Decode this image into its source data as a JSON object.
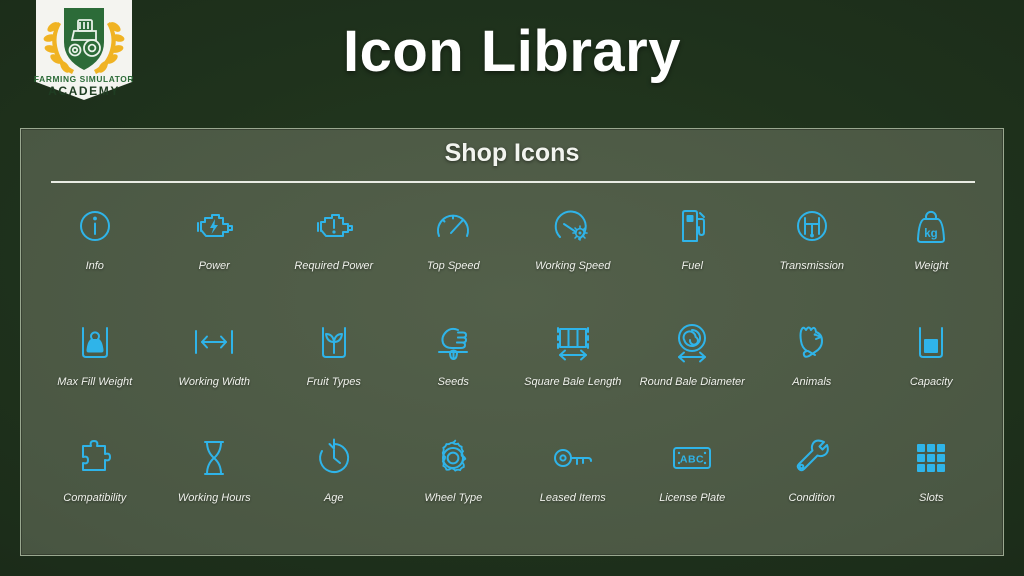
{
  "header": {
    "title": "Icon Library",
    "logo": {
      "name": "farming-simulator-academy-logo",
      "line1": "FARMING SIMULATOR",
      "line2": "ACADEMY"
    }
  },
  "panel": {
    "heading": "Shop Icons"
  },
  "colors": {
    "page_background": "#1c2d1a",
    "panel_background": "#4a5743",
    "panel_border": "#9aa890",
    "icon_accent": "#2fb4e9",
    "text": "#f0f2ec",
    "logo_shield_green": "#2c6b38",
    "logo_wheat_gold": "#f0b323"
  },
  "icons": [
    {
      "label": "Info",
      "icon": "info-circle-icon"
    },
    {
      "label": "Power",
      "icon": "engine-bolt-icon"
    },
    {
      "label": "Required Power",
      "icon": "engine-exclamation-icon"
    },
    {
      "label": "Top Speed",
      "icon": "speedometer-icon"
    },
    {
      "label": "Working Speed",
      "icon": "speedometer-gear-icon"
    },
    {
      "label": "Fuel",
      "icon": "fuel-pump-icon"
    },
    {
      "label": "Transmission",
      "icon": "gear-shifter-icon"
    },
    {
      "label": "Weight",
      "icon": "kg-weight-icon"
    },
    {
      "label": "Max Fill Weight",
      "icon": "weight-in-container-icon"
    },
    {
      "label": "Working Width",
      "icon": "width-arrow-icon"
    },
    {
      "label": "Fruit Types",
      "icon": "sprout-container-icon"
    },
    {
      "label": "Seeds",
      "icon": "hand-sowing-icon"
    },
    {
      "label": "Square Bale Length",
      "icon": "square-bale-arrow-icon"
    },
    {
      "label": "Round Bale Diameter",
      "icon": "round-bale-spiral-icon"
    },
    {
      "label": "Animals",
      "icon": "chicken-icon"
    },
    {
      "label": "Capacity",
      "icon": "capacity-container-icon"
    },
    {
      "label": "Compatibility",
      "icon": "puzzle-piece-icon"
    },
    {
      "label": "Working Hours",
      "icon": "hourglass-icon"
    },
    {
      "label": "Age",
      "icon": "clock-rotate-icon"
    },
    {
      "label": "Wheel Type",
      "icon": "tire-icon"
    },
    {
      "label": "Leased Items",
      "icon": "key-icon"
    },
    {
      "label": "License Plate",
      "icon": "license-plate-abc-icon"
    },
    {
      "label": "Condition",
      "icon": "wrench-icon"
    },
    {
      "label": "Slots",
      "icon": "grid-slots-icon"
    }
  ],
  "license_plate_text": "ABC",
  "weight_unit_text": "kg"
}
